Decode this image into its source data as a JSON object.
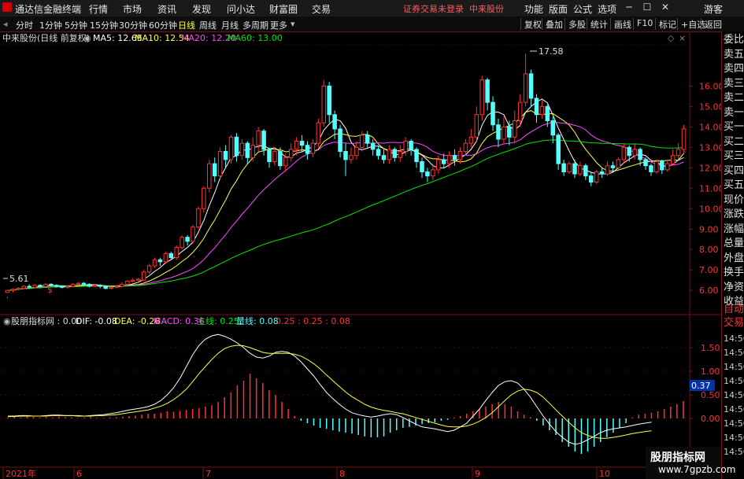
{
  "app": {
    "title": "通达信金融终端",
    "status": "证券交易未登录",
    "stock_name": "中来股份"
  },
  "menu": [
    "行情",
    "市场",
    "资讯",
    "发现",
    "问小达",
    "财富圈",
    "交易"
  ],
  "right_menu": [
    "功能",
    "版面",
    "公式",
    "选项",
    "游客"
  ],
  "periods": [
    "分时",
    "1分钟",
    "5分钟",
    "15分钟",
    "30分钟",
    "60分钟",
    "日线",
    "周线",
    "月线",
    "多周期",
    "更多"
  ],
  "active_period": "日线",
  "toolbar": [
    "复权",
    "叠加",
    "多股",
    "统计",
    "画线",
    "F10",
    "标记",
    "+自选",
    "返回"
  ],
  "main_legend": {
    "title": "中来股份(日线 前复权)",
    "ma5": "MA5: 12.65",
    "ma10": "MA10: 12.54",
    "ma20": "MA20: 12.20",
    "ma60": "MA60: 13.00"
  },
  "sub_legend": {
    "title": "股朋指标网 : 0.00",
    "dif": "DIF: -0.08",
    "dea": "DEA: -0.26",
    "macd": "MACD: 0.36",
    "zhu": "主线: 0.25",
    "liang": "量线: 0.08",
    "extra": "0.25 : 0.25 : 0.08"
  },
  "colors": {
    "up": "#ff3232",
    "down": "#54ffff",
    "ma5": "#ffffff",
    "ma10": "#ffff4a",
    "ma20": "#ff4aff",
    "ma60": "#00e600",
    "axis": "#7a1010"
  },
  "price_axis": [
    "16.00",
    "15.00",
    "14.00",
    "13.00",
    "12.00",
    "11.00",
    "10.00",
    "9.00",
    "8.00",
    "7.00",
    "6.00"
  ],
  "macd_axis": [
    "1.50",
    "1.00",
    "0.50",
    "0.00"
  ],
  "macd_current": "0.37",
  "high_label": "17.58",
  "low_label": "5.61",
  "date_axis": [
    "2021年",
    "6",
    "7",
    "8",
    "9",
    "10"
  ],
  "right_panel": {
    "labels": [
      "委比",
      "卖五",
      "卖四",
      "卖三",
      "卖二",
      "卖一",
      "买一",
      "买二",
      "买三",
      "买四",
      "买五",
      "现价",
      "涨跌",
      "涨幅",
      "总量",
      "外盘",
      "换手",
      "净资",
      "收益",
      "自动",
      "交易"
    ],
    "times": [
      "14:56",
      "14:56",
      "14:56",
      "14:56",
      "14:56",
      "14:56",
      "14:56",
      "14:56",
      "14:56"
    ]
  },
  "watermark": {
    "line1": "股朋指标网",
    "line2": "www.7gpzb.com"
  },
  "chart_data": {
    "type": "candlestick",
    "title": "中来股份(日线 前复权)",
    "ylim": [
      5.2,
      17.9
    ],
    "candles": [
      [
        5.9,
        6.0,
        5.7,
        5.61
      ],
      [
        6.0,
        6.05,
        5.9,
        6.1
      ],
      [
        6.05,
        6.1,
        6.0,
        6.15
      ],
      [
        6.1,
        6.2,
        6.05,
        6.25
      ],
      [
        6.2,
        6.15,
        6.1,
        6.3
      ],
      [
        6.15,
        6.25,
        6.1,
        6.3
      ],
      [
        6.25,
        6.2,
        6.15,
        6.3
      ],
      [
        6.2,
        6.3,
        6.15,
        6.35
      ],
      [
        6.3,
        6.25,
        6.2,
        6.35
      ],
      [
        6.25,
        6.2,
        6.15,
        6.3
      ],
      [
        6.2,
        6.15,
        6.1,
        6.25
      ],
      [
        6.15,
        6.2,
        6.1,
        6.25
      ],
      [
        6.2,
        6.3,
        6.15,
        6.35
      ],
      [
        6.3,
        6.35,
        6.25,
        6.4
      ],
      [
        6.35,
        6.3,
        6.2,
        6.4
      ],
      [
        6.3,
        6.2,
        6.15,
        6.35
      ],
      [
        6.2,
        6.25,
        6.15,
        6.3
      ],
      [
        6.25,
        6.2,
        6.1,
        6.3
      ],
      [
        6.2,
        6.1,
        6.05,
        6.25
      ],
      [
        6.1,
        6.15,
        6.05,
        6.2
      ],
      [
        6.15,
        6.2,
        6.1,
        6.25
      ],
      [
        6.2,
        6.3,
        6.15,
        6.4
      ],
      [
        6.3,
        6.45,
        6.25,
        6.5
      ],
      [
        6.45,
        6.5,
        6.4,
        6.6
      ],
      [
        6.5,
        6.55,
        6.45,
        6.6
      ],
      [
        6.5,
        6.9,
        6.45,
        7.0
      ],
      [
        6.9,
        7.2,
        6.8,
        7.3
      ],
      [
        7.2,
        7.5,
        7.1,
        7.6
      ],
      [
        7.5,
        7.4,
        7.2,
        7.6
      ],
      [
        7.4,
        7.8,
        7.3,
        7.9
      ],
      [
        7.8,
        7.6,
        7.5,
        7.9
      ],
      [
        7.6,
        8.1,
        7.5,
        8.2
      ],
      [
        8.1,
        8.6,
        8.0,
        8.7
      ],
      [
        8.6,
        8.4,
        8.2,
        8.7
      ],
      [
        8.4,
        9.1,
        8.3,
        9.2
      ],
      [
        9.1,
        10.0,
        9.0,
        10.1
      ],
      [
        10.0,
        11.0,
        9.8,
        11.1
      ],
      [
        11.0,
        12.2,
        10.8,
        12.4
      ],
      [
        12.2,
        11.6,
        11.3,
        12.5
      ],
      [
        11.6,
        12.8,
        11.4,
        13.0
      ],
      [
        12.8,
        12.4,
        12.0,
        13.1
      ],
      [
        12.4,
        13.5,
        12.2,
        13.6
      ],
      [
        13.5,
        12.6,
        12.3,
        13.7
      ],
      [
        12.6,
        13.2,
        12.4,
        13.4
      ],
      [
        13.2,
        12.5,
        12.2,
        13.3
      ],
      [
        12.5,
        13.1,
        12.3,
        13.5
      ],
      [
        13.1,
        13.8,
        12.8,
        14.0
      ],
      [
        13.8,
        12.9,
        12.6,
        13.9
      ],
      [
        12.9,
        12.3,
        12.0,
        13.0
      ],
      [
        12.3,
        12.8,
        12.1,
        13.0
      ],
      [
        12.8,
        12.1,
        11.9,
        13.0
      ],
      [
        12.1,
        12.5,
        11.8,
        12.7
      ],
      [
        12.5,
        12.9,
        12.3,
        13.2
      ],
      [
        12.9,
        13.3,
        12.6,
        13.5
      ],
      [
        13.3,
        13.1,
        12.8,
        13.6
      ],
      [
        13.1,
        12.7,
        12.4,
        13.3
      ],
      [
        12.7,
        13.2,
        12.5,
        13.4
      ],
      [
        13.2,
        14.2,
        13.0,
        14.4
      ],
      [
        14.2,
        16.0,
        14.0,
        16.3
      ],
      [
        16.0,
        14.6,
        14.2,
        16.2
      ],
      [
        14.6,
        13.9,
        13.4,
        14.8
      ],
      [
        13.9,
        12.8,
        12.5,
        14.1
      ],
      [
        12.8,
        12.4,
        11.6,
        13.2
      ],
      [
        12.4,
        12.6,
        12.2,
        13.0
      ],
      [
        12.6,
        13.0,
        12.4,
        13.3
      ],
      [
        13.0,
        13.6,
        12.8,
        13.8
      ],
      [
        13.6,
        13.2,
        13.0,
        13.8
      ],
      [
        13.2,
        12.9,
        12.6,
        13.4
      ],
      [
        12.9,
        12.6,
        12.4,
        13.1
      ],
      [
        12.6,
        12.4,
        12.2,
        12.9
      ],
      [
        12.4,
        12.9,
        12.2,
        13.1
      ],
      [
        12.9,
        12.5,
        12.3,
        13.0
      ],
      [
        12.5,
        12.8,
        12.3,
        13.1
      ],
      [
        12.8,
        13.3,
        12.6,
        13.5
      ],
      [
        13.3,
        12.9,
        12.6,
        13.4
      ],
      [
        12.9,
        12.3,
        12.0,
        13.0
      ],
      [
        12.3,
        11.8,
        11.5,
        12.5
      ],
      [
        11.8,
        11.6,
        11.3,
        12.0
      ],
      [
        11.6,
        11.9,
        11.4,
        12.2
      ],
      [
        11.9,
        12.4,
        11.7,
        12.6
      ],
      [
        12.4,
        12.2,
        12.0,
        12.7
      ],
      [
        12.2,
        12.6,
        12.0,
        12.8
      ],
      [
        12.6,
        12.4,
        12.1,
        12.9
      ],
      [
        12.4,
        12.8,
        12.2,
        13.0
      ],
      [
        12.8,
        13.2,
        12.6,
        13.4
      ],
      [
        13.2,
        13.5,
        13.0,
        13.9
      ],
      [
        13.5,
        14.6,
        13.3,
        15.0
      ],
      [
        14.6,
        16.3,
        14.3,
        16.5
      ],
      [
        16.3,
        15.2,
        14.8,
        16.4
      ],
      [
        15.2,
        14.1,
        13.8,
        15.5
      ],
      [
        14.1,
        13.4,
        13.0,
        14.4
      ],
      [
        13.4,
        14.0,
        13.2,
        14.5
      ],
      [
        14.0,
        13.5,
        13.1,
        14.3
      ],
      [
        13.5,
        14.3,
        13.2,
        14.8
      ],
      [
        14.3,
        15.2,
        14.0,
        15.6
      ],
      [
        15.2,
        16.6,
        15.0,
        17.58
      ],
      [
        16.6,
        15.4,
        15.0,
        16.8
      ],
      [
        15.4,
        14.6,
        14.2,
        15.6
      ],
      [
        14.6,
        15.0,
        14.4,
        15.3
      ],
      [
        15.0,
        14.3,
        14.0,
        15.1
      ],
      [
        14.3,
        13.6,
        13.2,
        14.5
      ],
      [
        13.6,
        12.2,
        11.9,
        13.7
      ],
      [
        12.2,
        11.8,
        11.6,
        12.4
      ],
      [
        11.8,
        12.2,
        11.7,
        12.3
      ],
      [
        12.2,
        11.7,
        11.5,
        12.4
      ],
      [
        11.7,
        12.1,
        11.6,
        12.3
      ],
      [
        12.1,
        11.6,
        11.4,
        12.2
      ],
      [
        11.6,
        11.3,
        11.1,
        11.8
      ],
      [
        11.3,
        11.8,
        11.2,
        11.9
      ],
      [
        11.8,
        11.7,
        11.5,
        12.0
      ],
      [
        11.7,
        12.1,
        11.6,
        12.3
      ],
      [
        12.1,
        12.0,
        11.8,
        12.3
      ],
      [
        12.0,
        12.4,
        11.9,
        12.5
      ],
      [
        12.4,
        13.0,
        12.2,
        13.2
      ],
      [
        13.0,
        12.6,
        12.3,
        13.1
      ],
      [
        12.6,
        12.9,
        12.4,
        13.2
      ],
      [
        12.9,
        12.4,
        12.1,
        13.0
      ],
      [
        12.4,
        12.1,
        11.9,
        12.5
      ],
      [
        12.1,
        11.8,
        11.6,
        12.2
      ],
      [
        11.8,
        12.3,
        11.7,
        12.4
      ],
      [
        12.3,
        11.9,
        11.7,
        12.4
      ],
      [
        11.9,
        12.2,
        11.8,
        12.4
      ],
      [
        12.2,
        12.6,
        12.1,
        12.9
      ],
      [
        12.6,
        12.9,
        12.4,
        13.2
      ],
      [
        12.9,
        13.9,
        12.7,
        14.1
      ]
    ],
    "macd_hist": [
      0.02,
      0.03,
      0.02,
      0.04,
      0.03,
      0.02,
      0.03,
      0.02,
      0.04,
      0.03,
      0.02,
      0.01,
      0.02,
      0.03,
      0.02,
      0.01,
      0.02,
      0.03,
      0.04,
      0.05,
      0.06,
      0.08,
      0.1,
      0.1,
      0.12,
      0.15,
      0.14,
      0.16,
      0.18,
      0.2,
      0.22,
      0.25,
      0.28,
      0.35,
      0.45,
      0.55,
      0.7,
      0.8,
      0.95,
      0.85,
      0.75,
      0.6,
      0.5,
      0.35,
      0.2,
      0.05,
      -0.05,
      -0.1,
      -0.15,
      -0.2,
      -0.22,
      -0.25,
      -0.28,
      -0.3,
      -0.32,
      -0.35,
      -0.38,
      -0.4,
      -0.4,
      -0.38,
      -0.3,
      -0.25,
      -0.2,
      -0.18,
      -0.15,
      -0.12,
      -0.1,
      -0.08,
      -0.05,
      -0.03,
      0.02,
      0.05,
      0.1,
      0.15,
      0.2,
      0.25,
      0.3,
      0.35,
      0.3,
      0.25,
      0.15,
      0.08,
      0.03,
      -0.05,
      -0.15,
      -0.25,
      -0.35,
      -0.5,
      -0.6,
      -0.7,
      -0.75,
      -0.7,
      -0.6,
      -0.5,
      -0.4,
      -0.3,
      -0.2,
      -0.1,
      0.02,
      0.08,
      0.1,
      0.12,
      0.15,
      0.2,
      0.25,
      0.3,
      0.37
    ],
    "dif": [
      0.05,
      0.05,
      0.06,
      0.06,
      0.05,
      0.05,
      0.06,
      0.07,
      0.07,
      0.06,
      0.06,
      0.05,
      0.05,
      0.06,
      0.07,
      0.08,
      0.1,
      0.12,
      0.15,
      0.18,
      0.2,
      0.22,
      0.25,
      0.3,
      0.38,
      0.5,
      0.65,
      0.85,
      1.1,
      1.35,
      1.55,
      1.68,
      1.75,
      1.78,
      1.74,
      1.68,
      1.6,
      1.5,
      1.38,
      1.3,
      1.28,
      1.32,
      1.4,
      1.42,
      1.4,
      1.32,
      1.2,
      1.05,
      0.9,
      0.72,
      0.55,
      0.42,
      0.3,
      0.2,
      0.12,
      0.08,
      0.05,
      0.03,
      0.05,
      0.08,
      0.1,
      0.08,
      0.02,
      -0.05,
      -0.12,
      -0.18,
      -0.2,
      -0.22,
      -0.25,
      -0.28,
      -0.25,
      -0.18,
      -0.1,
      0.05,
      0.2,
      0.38,
      0.55,
      0.7,
      0.78,
      0.8,
      0.75,
      0.62,
      0.45,
      0.25,
      0.05,
      -0.12,
      -0.28,
      -0.4,
      -0.5,
      -0.55,
      -0.52,
      -0.45,
      -0.38,
      -0.3,
      -0.25,
      -0.22,
      -0.2,
      -0.18,
      -0.15,
      -0.12,
      -0.1,
      -0.08
    ],
    "dea": [
      0.04,
      0.04,
      0.05,
      0.05,
      0.05,
      0.05,
      0.05,
      0.06,
      0.06,
      0.06,
      0.06,
      0.06,
      0.05,
      0.05,
      0.06,
      0.06,
      0.07,
      0.08,
      0.1,
      0.12,
      0.14,
      0.16,
      0.18,
      0.22,
      0.26,
      0.32,
      0.4,
      0.5,
      0.62,
      0.78,
      0.95,
      1.1,
      1.25,
      1.38,
      1.48,
      1.53,
      1.55,
      1.54,
      1.5,
      1.45,
      1.4,
      1.38,
      1.38,
      1.38,
      1.38,
      1.36,
      1.32,
      1.25,
      1.16,
      1.05,
      0.92,
      0.8,
      0.68,
      0.56,
      0.46,
      0.38,
      0.3,
      0.24,
      0.2,
      0.17,
      0.15,
      0.12,
      0.1,
      0.06,
      0.02,
      -0.02,
      -0.06,
      -0.1,
      -0.14,
      -0.17,
      -0.18,
      -0.18,
      -0.16,
      -0.12,
      -0.06,
      0.02,
      0.12,
      0.25,
      0.38,
      0.5,
      0.58,
      0.62,
      0.6,
      0.55,
      0.45,
      0.32,
      0.18,
      0.05,
      -0.08,
      -0.2,
      -0.3,
      -0.36,
      -0.4,
      -0.42,
      -0.42,
      -0.4,
      -0.38,
      -0.35,
      -0.32,
      -0.3,
      -0.28,
      -0.26
    ]
  }
}
